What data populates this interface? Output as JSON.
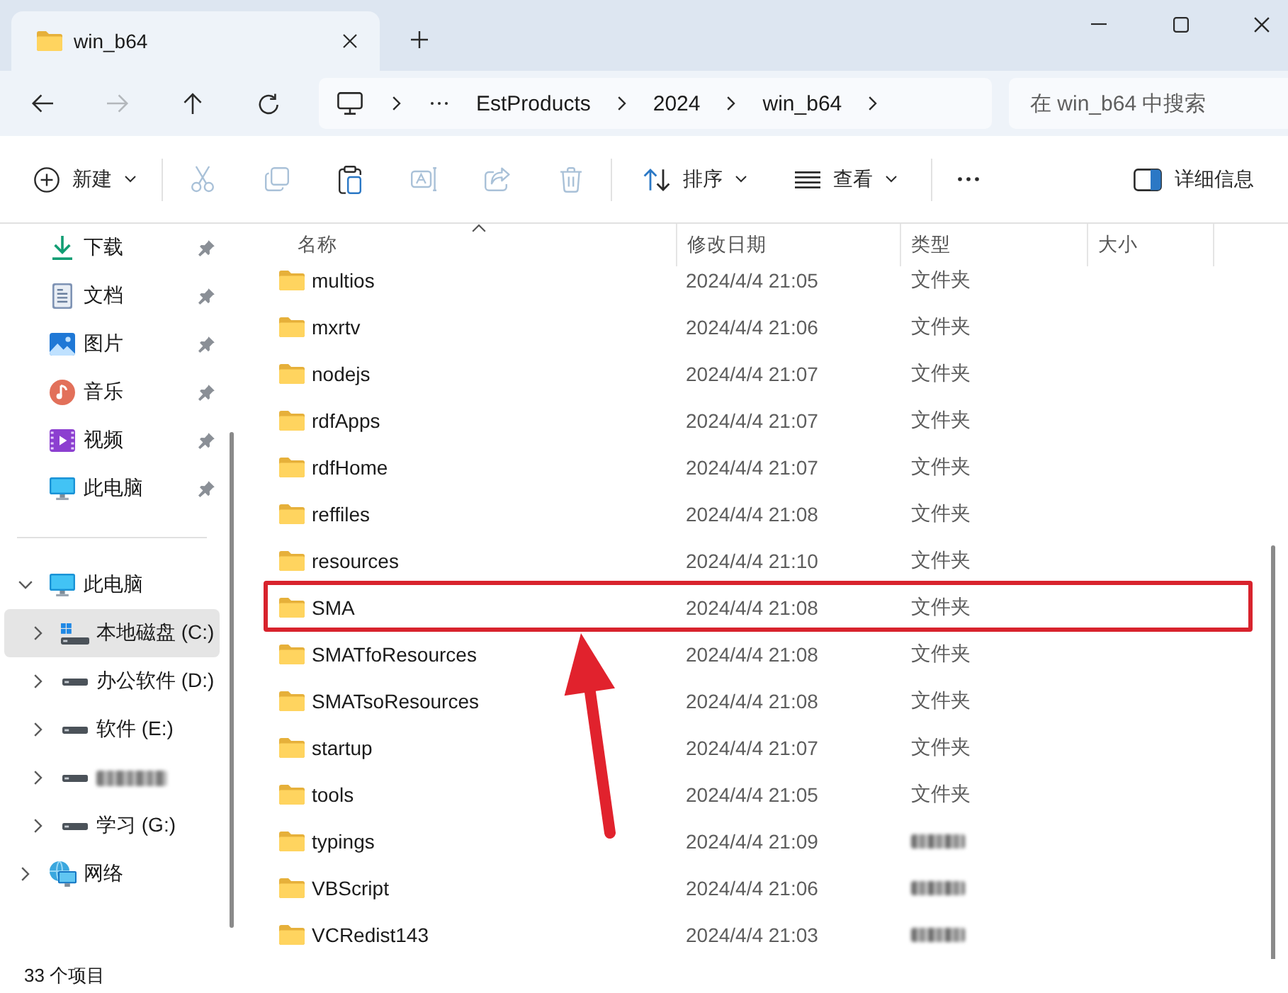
{
  "window": {
    "tab_title": "win_b64"
  },
  "navigation": [
    {
      "kind": "back",
      "disabled": false
    },
    {
      "kind": "forward",
      "disabled": true
    },
    {
      "kind": "up",
      "disabled": false
    },
    {
      "kind": "refresh",
      "disabled": false
    }
  ],
  "address_bar": {
    "breadcrumbs": [
      "EstProducts",
      "2024",
      "win_b64"
    ]
  },
  "search": {
    "placeholder": "在 win_b64 中搜索"
  },
  "toolbar": {
    "items": [
      {
        "kind": "new",
        "label": "新建",
        "disabled": false
      },
      {
        "kind": "separator"
      },
      {
        "kind": "cut",
        "disabled": true
      },
      {
        "kind": "copy",
        "disabled": true
      },
      {
        "kind": "paste",
        "disabled": false
      },
      {
        "kind": "rename",
        "disabled": true
      },
      {
        "kind": "share",
        "disabled": true
      },
      {
        "kind": "delete",
        "disabled": true
      },
      {
        "kind": "separator"
      },
      {
        "kind": "sort",
        "label": "排序",
        "disabled": false
      },
      {
        "kind": "view",
        "label": "查看",
        "disabled": false
      },
      {
        "kind": "separator"
      },
      {
        "kind": "more",
        "disabled": false
      },
      {
        "kind": "details",
        "label": "详细信息",
        "disabled": false
      }
    ]
  },
  "sidebar": {
    "quick_access": [
      {
        "kind": "downloads",
        "label": "下载",
        "pinned": true,
        "selected": false
      },
      {
        "kind": "documents",
        "label": "文档",
        "pinned": true,
        "selected": false
      },
      {
        "kind": "pictures",
        "label": "图片",
        "pinned": true,
        "selected": false
      },
      {
        "kind": "music",
        "label": "音乐",
        "pinned": true,
        "selected": false
      },
      {
        "kind": "videos",
        "label": "视频",
        "pinned": true,
        "selected": false
      },
      {
        "kind": "pc",
        "label": "此电脑",
        "pinned": true,
        "selected": false
      }
    ],
    "tree": [
      {
        "kind": "pc",
        "label": "此电脑",
        "expanded": true,
        "selected": false,
        "children": [
          {
            "kind": "system-drive",
            "label": "本地磁盘 (C:)",
            "expanded": false,
            "selected": true
          },
          {
            "kind": "drive",
            "label": "办公软件 (D:)",
            "expanded": false,
            "selected": false
          },
          {
            "kind": "drive",
            "label": "软件 (E:)",
            "expanded": false,
            "selected": false
          },
          {
            "kind": "drive",
            "redacted": true,
            "expanded": false,
            "selected": false
          },
          {
            "kind": "drive",
            "label": "学习 (G:)",
            "expanded": false,
            "selected": false
          }
        ]
      },
      {
        "kind": "network",
        "label": "网络",
        "expanded": false,
        "selected": false
      }
    ]
  },
  "file_list": {
    "columns": [
      {
        "label": "名称",
        "sorted": true
      },
      {
        "label": "修改日期",
        "sorted": false
      },
      {
        "label": "类型",
        "sorted": false
      },
      {
        "label": "大小",
        "sorted": false
      }
    ],
    "rows": [
      {
        "name": "multios",
        "modified": "2024/4/4 21:05",
        "type": "文件夹",
        "highlighted": false
      },
      {
        "name": "mxrtv",
        "modified": "2024/4/4 21:06",
        "type": "文件夹",
        "highlighted": false
      },
      {
        "name": "nodejs",
        "modified": "2024/4/4 21:07",
        "type": "文件夹",
        "highlighted": false
      },
      {
        "name": "rdfApps",
        "modified": "2024/4/4 21:07",
        "type": "文件夹",
        "highlighted": false
      },
      {
        "name": "rdfHome",
        "modified": "2024/4/4 21:07",
        "type": "文件夹",
        "highlighted": false
      },
      {
        "name": "reffiles",
        "modified": "2024/4/4 21:08",
        "type": "文件夹",
        "highlighted": false
      },
      {
        "name": "resources",
        "modified": "2024/4/4 21:10",
        "type": "文件夹",
        "highlighted": false
      },
      {
        "name": "SMA",
        "modified": "2024/4/4 21:08",
        "type": "文件夹",
        "highlighted": true
      },
      {
        "name": "SMATfoResources",
        "modified": "2024/4/4 21:08",
        "type": "文件夹",
        "highlighted": false
      },
      {
        "name": "SMATsoResources",
        "modified": "2024/4/4 21:08",
        "type": "文件夹",
        "highlighted": false
      },
      {
        "name": "startup",
        "modified": "2024/4/4 21:07",
        "type": "文件夹",
        "highlighted": false
      },
      {
        "name": "tools",
        "modified": "2024/4/4 21:05",
        "type": "文件夹",
        "highlighted": false
      },
      {
        "name": "typings",
        "modified": "2024/4/4 21:09",
        "type_redacted": true,
        "highlighted": false
      },
      {
        "name": "VBScript",
        "modified": "2024/4/4 21:06",
        "type_redacted": true,
        "highlighted": false
      },
      {
        "name": "VCRedist143",
        "modified": "2024/4/4 21:03",
        "type_redacted": true,
        "highlighted": false
      }
    ],
    "arrow_to_highlighted": true
  },
  "status_bar": {
    "item_count": "33 个项目"
  }
}
